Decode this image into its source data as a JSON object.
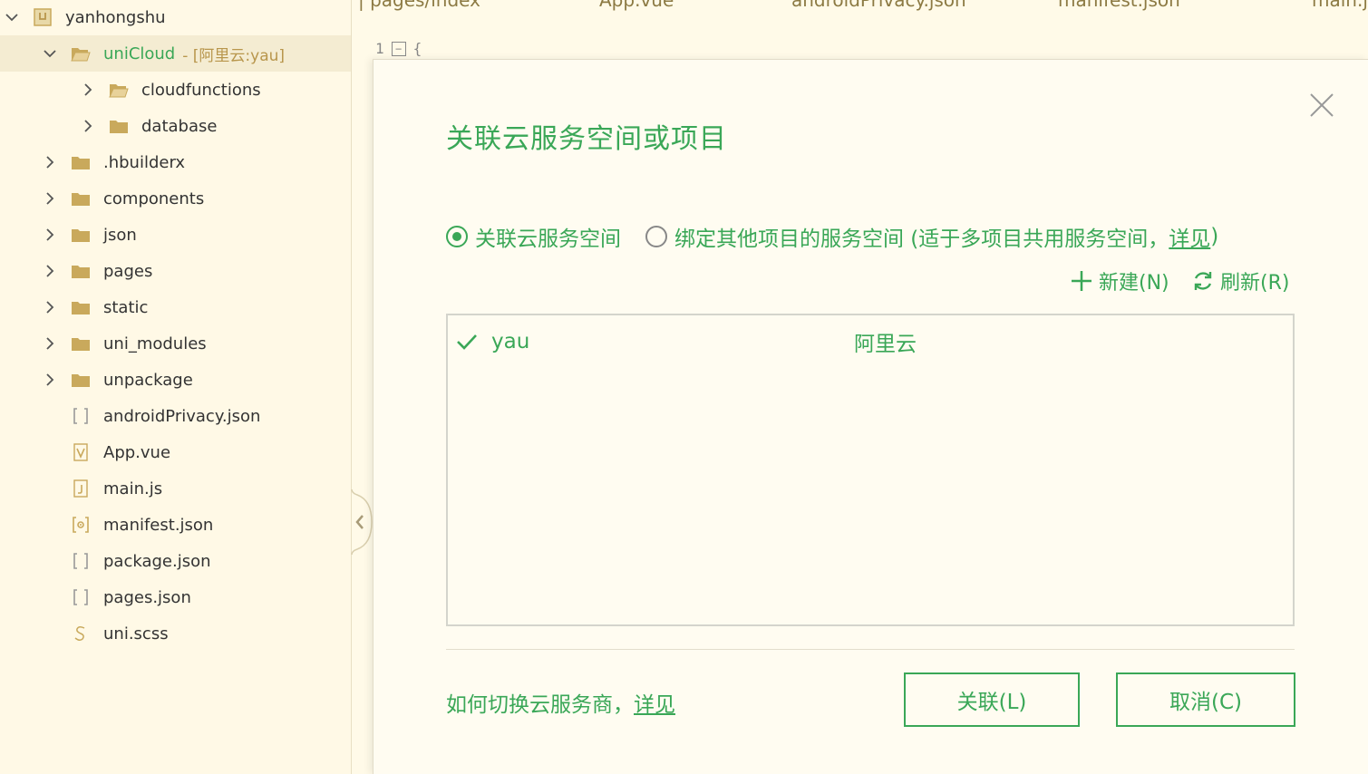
{
  "tabs": [
    "| pages/index",
    "App.vue",
    "androidPrivacy.json",
    "manifest.json",
    "main.js"
  ],
  "editor": {
    "line_number": "1",
    "code": "{"
  },
  "sidebar": {
    "items": [
      {
        "label": "yanhongshu",
        "level": 0,
        "chevron": "down",
        "icon": "project-icon"
      },
      {
        "label": "uniCloud",
        "suffix": "- [阿里云:yau]",
        "level": 1,
        "chevron": "down",
        "icon": "open-folder-icon",
        "selected": true
      },
      {
        "label": "cloudfunctions",
        "level": 2,
        "chevron": "right",
        "icon": "open-folder-icon"
      },
      {
        "label": "database",
        "level": 2,
        "chevron": "right",
        "icon": "folder-icon"
      },
      {
        "label": ".hbuilderx",
        "level": 1,
        "chevron": "right",
        "icon": "folder-icon"
      },
      {
        "label": "components",
        "level": 1,
        "chevron": "right",
        "icon": "folder-icon"
      },
      {
        "label": "json",
        "level": 1,
        "chevron": "right",
        "icon": "folder-icon"
      },
      {
        "label": "pages",
        "level": 1,
        "chevron": "right",
        "icon": "folder-icon"
      },
      {
        "label": "static",
        "level": 1,
        "chevron": "right",
        "icon": "folder-icon"
      },
      {
        "label": "uni_modules",
        "level": 1,
        "chevron": "right",
        "icon": "folder-icon"
      },
      {
        "label": "unpackage",
        "level": 1,
        "chevron": "right",
        "icon": "folder-icon"
      },
      {
        "label": "androidPrivacy.json",
        "level": 1,
        "chevron": "none",
        "icon": "json-file-icon"
      },
      {
        "label": "App.vue",
        "level": 1,
        "chevron": "none",
        "icon": "vue-file-icon"
      },
      {
        "label": "main.js",
        "level": 1,
        "chevron": "none",
        "icon": "js-file-icon"
      },
      {
        "label": "manifest.json",
        "level": 1,
        "chevron": "none",
        "icon": "manifest-file-icon"
      },
      {
        "label": "package.json",
        "level": 1,
        "chevron": "none",
        "icon": "json-file-icon"
      },
      {
        "label": "pages.json",
        "level": 1,
        "chevron": "none",
        "icon": "json-file-icon"
      },
      {
        "label": "uni.scss",
        "level": 1,
        "chevron": "none",
        "icon": "scss-file-icon"
      }
    ]
  },
  "dialog": {
    "title": "关联云服务空间或项目",
    "radio_options": [
      {
        "label": "关联云服务空间",
        "checked": true
      },
      {
        "label": "绑定其他项目的服务空间 (适于多项目共用服务空间，",
        "link": "详见",
        "tail": ")",
        "checked": false
      }
    ],
    "actions": {
      "new_label": "新建(N)",
      "refresh_label": "刷新(R)"
    },
    "spaces": [
      {
        "name": "yau",
        "provider": "阿里云",
        "selected": true
      }
    ],
    "help_text": "如何切换云服务商，",
    "help_link": "详见",
    "associate_label": "关联(L)",
    "cancel_label": "取消(C)"
  },
  "colors": {
    "accent": "#3aa757",
    "background": "#fffae8",
    "dialog_bg": "#fffcf1",
    "folder": "#c9a95c"
  }
}
